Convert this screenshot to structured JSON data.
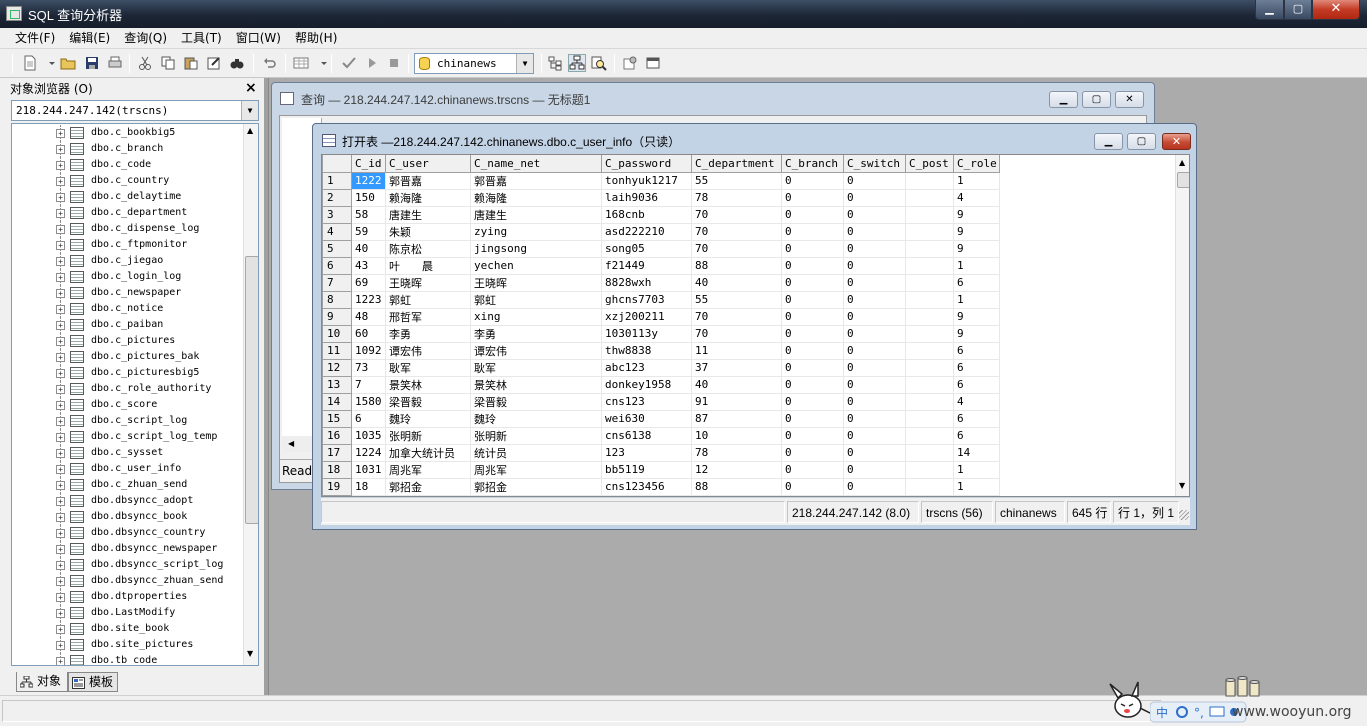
{
  "window": {
    "title": "SQL 查询分析器"
  },
  "menu": [
    "文件(F)",
    "编辑(E)",
    "查询(Q)",
    "工具(T)",
    "窗口(W)",
    "帮助(H)"
  ],
  "toolbar": {
    "database": "chinanews"
  },
  "object_browser": {
    "title": "对象浏览器 (O)",
    "close": "×",
    "server": "218.244.247.142(trscns)",
    "items": [
      "dbo.c_bookbig5",
      "dbo.c_branch",
      "dbo.c_code",
      "dbo.c_country",
      "dbo.c_delaytime",
      "dbo.c_department",
      "dbo.c_dispense_log",
      "dbo.c_ftpmonitor",
      "dbo.c_jiegao",
      "dbo.c_login_log",
      "dbo.c_newspaper",
      "dbo.c_notice",
      "dbo.c_paiban",
      "dbo.c_pictures",
      "dbo.c_pictures_bak",
      "dbo.c_picturesbig5",
      "dbo.c_role_authority",
      "dbo.c_score",
      "dbo.c_script_log",
      "dbo.c_script_log_temp",
      "dbo.c_sysset",
      "dbo.c_user_info",
      "dbo.c_zhuan_send",
      "dbo.dbsyncc_adopt",
      "dbo.dbsyncc_book",
      "dbo.dbsyncc_country",
      "dbo.dbsyncc_newspaper",
      "dbo.dbsyncc_script_log",
      "dbo.dbsyncc_zhuan_send",
      "dbo.dtproperties",
      "dbo.LastModify",
      "dbo.site_book",
      "dbo.site_pictures",
      "dbo.tb_code"
    ],
    "tabs": [
      "对象",
      "模板"
    ]
  },
  "query_window": {
    "title": "查询 — 218.244.247.142.chinanews.trscns — 无标题1",
    "status": "Ready"
  },
  "table_window": {
    "title": "打开表 —218.244.247.142.chinanews.dbo.c_user_info（只读）",
    "columns": [
      "C_id",
      "C_user",
      "C_name_net",
      "C_password",
      "C_department",
      "C_branch",
      "C_switch",
      "C_post",
      "C_role"
    ],
    "rows": [
      [
        "1",
        "1222",
        "郭晋嘉",
        "郭晋嘉",
        "tonhyuk1217",
        "55",
        "0",
        "0",
        "",
        "1"
      ],
      [
        "2",
        "150",
        "赖海隆",
        "赖海隆",
        "laih9036",
        "78",
        "0",
        "0",
        "",
        "4"
      ],
      [
        "3",
        "58",
        "唐建生",
        "唐建生",
        "168cnb",
        "70",
        "0",
        "0",
        "",
        "9"
      ],
      [
        "4",
        "59",
        "朱颖",
        "zying",
        "asd222210",
        "70",
        "0",
        "0",
        "",
        "9"
      ],
      [
        "5",
        "40",
        "陈京松",
        "jingsong",
        "song05",
        "70",
        "0",
        "0",
        "",
        "9"
      ],
      [
        "6",
        "43",
        "叶　　晨",
        "yechen",
        "f21449",
        "88",
        "0",
        "0",
        "",
        "1"
      ],
      [
        "7",
        "69",
        "王晓晖",
        "王晓晖",
        "8828wxh",
        "40",
        "0",
        "0",
        "",
        "6"
      ],
      [
        "8",
        "1223",
        "郭虹",
        "郭虹",
        "ghcns7703",
        "55",
        "0",
        "0",
        "",
        "1"
      ],
      [
        "9",
        "48",
        "邢哲军",
        "xing",
        "xzj200211",
        "70",
        "0",
        "0",
        "",
        "9"
      ],
      [
        "10",
        "60",
        "李勇",
        "李勇",
        "1030113y",
        "70",
        "0",
        "0",
        "",
        "9"
      ],
      [
        "11",
        "1092",
        "谭宏伟",
        "谭宏伟",
        "thw8838",
        "11",
        "0",
        "0",
        "",
        "6"
      ],
      [
        "12",
        "73",
        "耿军",
        "耿军",
        "abc123",
        "37",
        "0",
        "0",
        "",
        "6"
      ],
      [
        "13",
        "7",
        "景笑林",
        "景笑林",
        "donkey1958",
        "40",
        "0",
        "0",
        "",
        "6"
      ],
      [
        "14",
        "1580",
        "梁晋毅",
        "梁晋毅",
        "cns123",
        "91",
        "0",
        "0",
        "",
        "4"
      ],
      [
        "15",
        "6",
        "魏玲",
        "魏玲",
        "wei630",
        "87",
        "0",
        "0",
        "",
        "6"
      ],
      [
        "16",
        "1035",
        "张明新",
        "张明新",
        "cns6138",
        "10",
        "0",
        "0",
        "",
        "6"
      ],
      [
        "17",
        "1224",
        "加拿大统计员",
        "统计员",
        "123",
        "78",
        "0",
        "0",
        "",
        "14"
      ],
      [
        "18",
        "1031",
        "周兆军",
        "周兆军",
        "bb5119",
        "12",
        "0",
        "0",
        "",
        "1"
      ],
      [
        "19",
        "18",
        "郭招金",
        "郭招金",
        "cns123456",
        "88",
        "0",
        "0",
        "",
        "1"
      ]
    ],
    "status": {
      "server": "218.244.247.142 (8.0)",
      "user": "trscns (56)",
      "db": "chinanews",
      "rows": "645 行",
      "pos": "行 1，列 1"
    }
  },
  "watermark": "www.wooyun.org"
}
